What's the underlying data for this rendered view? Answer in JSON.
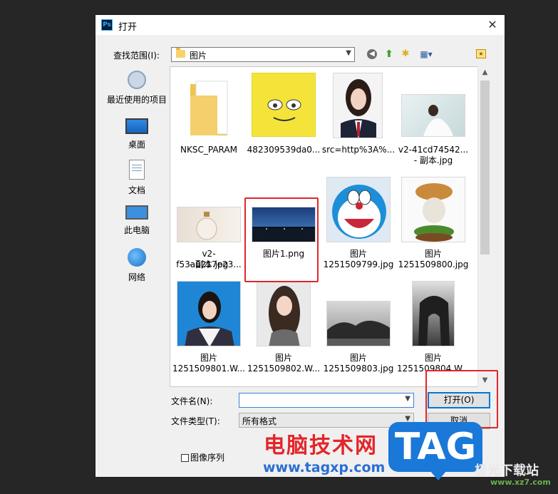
{
  "dialog": {
    "app_icon_text": "Ps",
    "title": "打开",
    "close_glyph": "✕"
  },
  "toolbar": {
    "look_in_label": "查找范围(I):",
    "look_in_value": "图片"
  },
  "places": [
    {
      "label": "最近使用的项目",
      "icon": "recent-icon"
    },
    {
      "label": "桌面",
      "icon": "desktop-icon"
    },
    {
      "label": "文档",
      "icon": "documents-icon"
    },
    {
      "label": "此电脑",
      "icon": "computer-icon"
    },
    {
      "label": "网络",
      "icon": "network-icon"
    }
  ],
  "files": [
    {
      "line1": "NKSC_PARAM",
      "line2": "",
      "thumb": "folder"
    },
    {
      "line1": "482309539da0...",
      "line2": "",
      "thumb": "spongebob"
    },
    {
      "line1": "src=http%3A%...",
      "line2": "",
      "thumb": "portrait-woman"
    },
    {
      "line1": "v2-41cd74542...",
      "line2": "- 副本.jpg",
      "thumb": "woman-white-dress"
    },
    {
      "line1": "v2-f53a0217e23...",
      "line2": "- 副本.jpg",
      "thumb": "perfume-bottle"
    },
    {
      "line1": "图片1.png",
      "line2": "",
      "thumb": "city-night",
      "selected": true
    },
    {
      "line1": "图片",
      "line2": "1251509799.jpg",
      "thumb": "doraemon"
    },
    {
      "line1": "图片",
      "line2": "1251509800.jpg",
      "thumb": "burger-cat"
    },
    {
      "line1": "图片",
      "line2": "1251509801.W...",
      "thumb": "girl-blue-bg"
    },
    {
      "line1": "图片",
      "line2": "1251509802.W...",
      "thumb": "girl-grey-bg"
    },
    {
      "line1": "图片",
      "line2": "1251509803.jpg",
      "thumb": "rock-landscape"
    },
    {
      "line1": "图片",
      "line2": "1251509804.W...",
      "thumb": "rock-arch"
    }
  ],
  "bottom": {
    "filename_label": "文件名(N):",
    "filename_value": "",
    "filetype_label": "文件类型(T):",
    "filetype_value": "所有格式",
    "open_button": "打开(O)",
    "cancel_button": "取消",
    "image_sequence_label": "图像序列"
  },
  "watermark": {
    "cn_text": "电脑技术网",
    "url": "www.tagxp.com",
    "tag": "TAG",
    "site": "极光下载站",
    "site2": "www.xz7.com"
  }
}
